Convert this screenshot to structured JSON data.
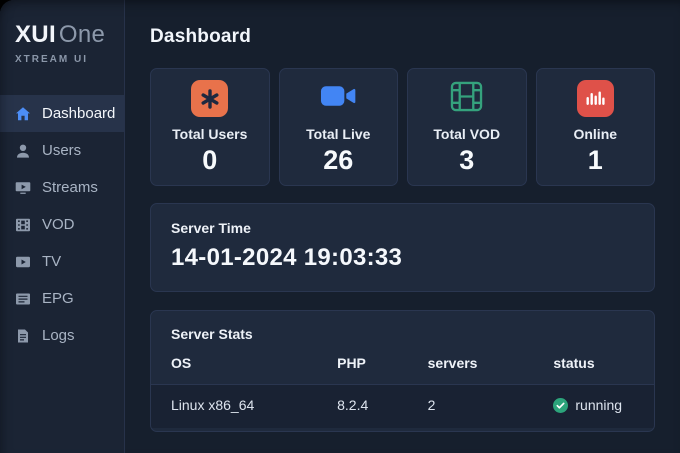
{
  "brand": {
    "primary": "XUI",
    "secondary": "One",
    "subtitle": "XTREAM UI"
  },
  "header": {
    "title": "Dashboard"
  },
  "sidebar": {
    "items": [
      {
        "label": "Dashboard",
        "icon": "home-icon",
        "active": true
      },
      {
        "label": "Users",
        "icon": "users-icon",
        "active": false
      },
      {
        "label": "Streams",
        "icon": "stream-monitor-icon",
        "active": false
      },
      {
        "label": "VOD",
        "icon": "film-icon",
        "active": false
      },
      {
        "label": "TV",
        "icon": "tv-play-icon",
        "active": false
      },
      {
        "label": "EPG",
        "icon": "epg-list-icon",
        "active": false
      },
      {
        "label": "Logs",
        "icon": "logs-document-icon",
        "active": false
      }
    ]
  },
  "stats_cards": [
    {
      "label": "Total Users",
      "value": "0",
      "icon": "asterisk-icon",
      "accent": "#e8724b"
    },
    {
      "label": "Total Live",
      "value": "26",
      "icon": "video-camera-icon",
      "accent": "#4285f4"
    },
    {
      "label": "Total VOD",
      "value": "3",
      "icon": "film-strip-icon",
      "accent": "#35a27d"
    },
    {
      "label": "Online",
      "value": "1",
      "icon": "bar-chart-icon",
      "accent": "#df5149"
    }
  ],
  "server_time": {
    "title": "Server Time",
    "value": "14-01-2024 19:03:33"
  },
  "server_stats": {
    "title": "Server Stats",
    "columns": [
      "OS",
      "PHP",
      "servers",
      "status"
    ],
    "rows": [
      {
        "os": "Linux x86_64",
        "php": "8.2.4",
        "servers": "2",
        "status": "running",
        "status_icon": "check-circle-icon",
        "status_color": "#2ca47b"
      }
    ]
  },
  "colors": {
    "page_bg": "#161f2d",
    "sidebar_bg": "#1b2434",
    "card_bg": "#1f2a3d",
    "card_border": "#2a3650",
    "active_item_bg": "#27334a",
    "accent_blue": "#4285f4",
    "icon_orange": "#e8724b",
    "icon_green": "#35a27d",
    "icon_red": "#df5149",
    "status_green": "#2ca47b",
    "text_primary": "#f2f6fb",
    "text_muted": "#8d99ab"
  }
}
